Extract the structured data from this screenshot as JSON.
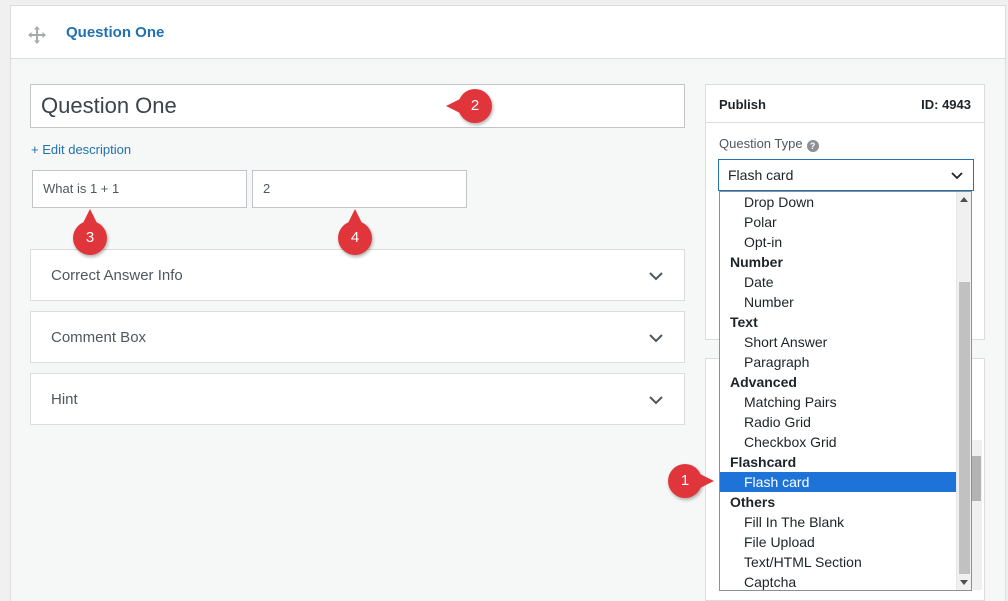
{
  "header": {
    "title": "Question One"
  },
  "question": {
    "title_value": "Question One",
    "edit_description": "+ Edit description",
    "answer_text": "What is 1 + 1",
    "answer_value": "2"
  },
  "accordions": [
    {
      "label": "Correct Answer Info"
    },
    {
      "label": "Comment Box"
    },
    {
      "label": "Hint"
    }
  ],
  "sidebar": {
    "publish": "Publish",
    "id_label": "ID: 4943",
    "question_type_label": "Question Type",
    "help_icon": "?",
    "selected_type": "Flash card"
  },
  "dropdown": {
    "items": [
      {
        "label": "Drop Down"
      },
      {
        "label": "Polar"
      },
      {
        "label": "Opt-in"
      },
      {
        "label": "Number"
      },
      {
        "label": "Date"
      },
      {
        "label": "Number"
      },
      {
        "label": "Text"
      },
      {
        "label": "Short Answer"
      },
      {
        "label": "Paragraph"
      },
      {
        "label": "Advanced"
      },
      {
        "label": "Matching Pairs"
      },
      {
        "label": "Radio Grid"
      },
      {
        "label": "Checkbox Grid"
      },
      {
        "label": "Flashcard"
      },
      {
        "label": "Flash card"
      },
      {
        "label": "Others"
      },
      {
        "label": "Fill In The Blank"
      },
      {
        "label": "File Upload"
      },
      {
        "label": "Text/HTML Section"
      },
      {
        "label": "Captcha"
      }
    ]
  },
  "callouts": {
    "one": "1",
    "two": "2",
    "three": "3",
    "four": "4"
  },
  "icons": {
    "move": "move-icon",
    "chevron": "chevron-down-icon",
    "help": "help-icon"
  },
  "colors": {
    "accent": "#2271b1",
    "selected": "#1e73d9",
    "callout": "#e0363b"
  }
}
